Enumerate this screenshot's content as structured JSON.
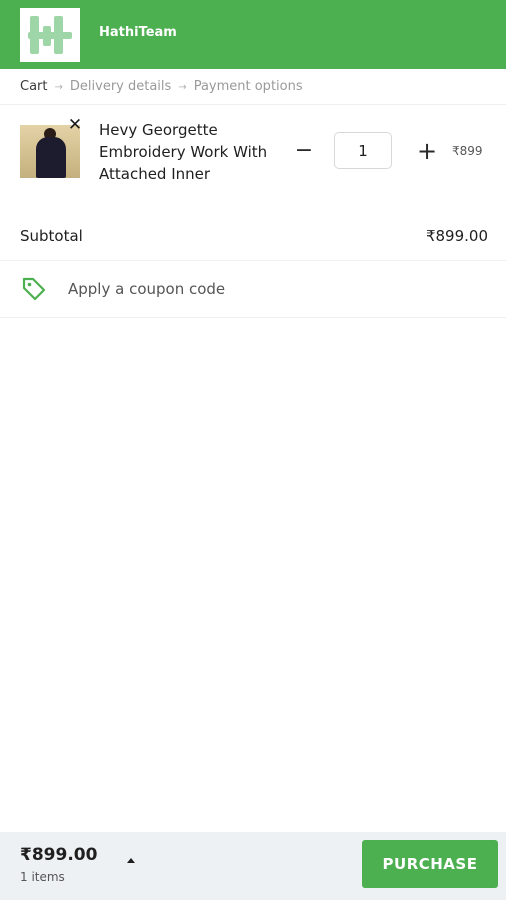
{
  "header": {
    "store_name": "HathiTeam",
    "logo_icon": "hathiteam-logo-icon",
    "brand_color": "#4caf50"
  },
  "breadcrumb": {
    "steps": [
      "Cart",
      "Delivery details",
      "Payment options"
    ],
    "arrow": "→",
    "active_index": 0
  },
  "cart": {
    "items": [
      {
        "name": "Hevy Georgette Embroidery Work With Attached Inner",
        "quantity": "1",
        "price": "₹899",
        "remove_icon": "close-icon",
        "minus_icon": "minus-icon",
        "plus_icon": "plus-icon"
      }
    ],
    "subtotal_label": "Subtotal",
    "subtotal_value": "₹899.00",
    "coupon_label": "Apply a coupon code",
    "coupon_icon": "tag-icon"
  },
  "footer": {
    "total": "₹899.00",
    "item_count": "1 items",
    "expand_icon": "caret-up-icon",
    "purchase_label": "PURCHASE"
  }
}
